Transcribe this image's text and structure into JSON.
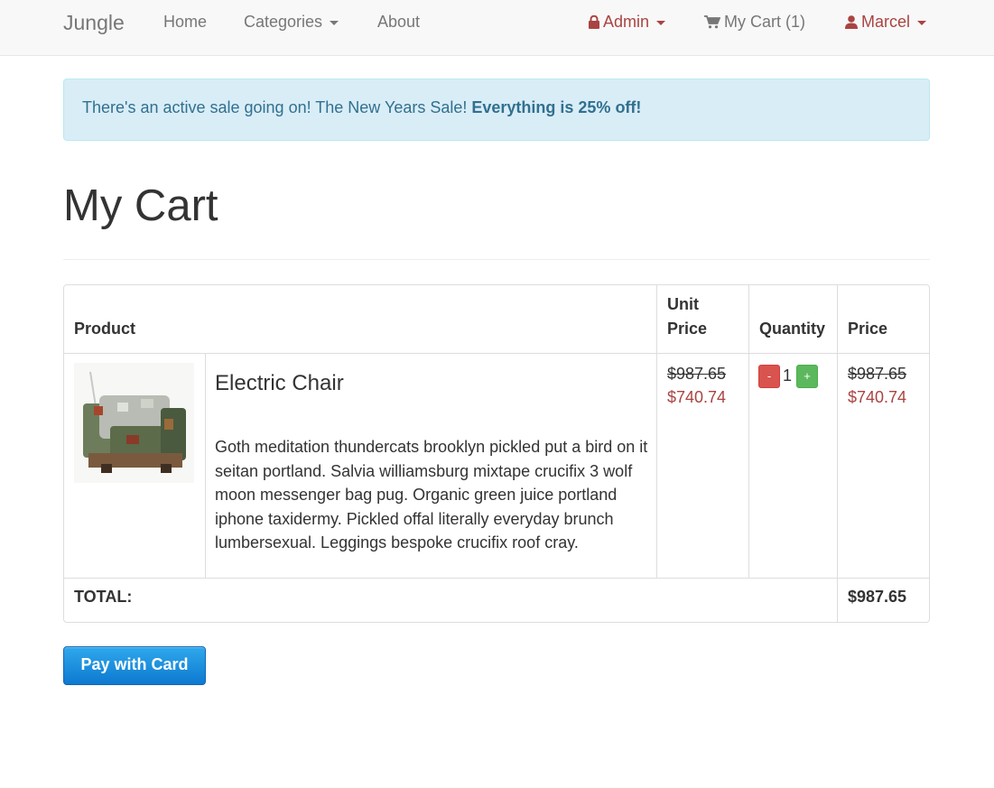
{
  "nav": {
    "brand": "Jungle",
    "home": "Home",
    "categories": "Categories",
    "about": "About",
    "admin": "Admin",
    "cart": "My Cart (1)",
    "user": "Marcel"
  },
  "alert": {
    "text": "There's an active sale going on! The New Years Sale! ",
    "highlight": "Everything is 25% off!"
  },
  "page": {
    "title": "My Cart"
  },
  "table": {
    "headers": {
      "product": "Product",
      "unit_price_1": "Unit",
      "unit_price_2": "Price",
      "quantity": "Quantity",
      "price": "Price"
    },
    "items": [
      {
        "name": "Electric Chair",
        "description": "Goth meditation thundercats brooklyn pickled put a bird on it seitan portland. Salvia williamsburg mixtape crucifix 3 wolf moon messenger bag pug. Organic green juice portland iphone taxidermy. Pickled offal literally everyday brunch lumbersexual. Leggings bespoke crucifix roof cray.",
        "unit_price_old": "$987.65",
        "unit_price_new": "$740.74",
        "quantity": "1",
        "minus_label": "-",
        "plus_label": "+",
        "price_old": "$987.65",
        "price_new": "$740.74"
      }
    ],
    "total_label": "TOTAL:",
    "total_value": "$987.65"
  },
  "pay_button": "Pay with Card",
  "colors": {
    "accent_red": "#a94442",
    "alert_bg": "#d9edf7",
    "pay_blue": "#1a8fe0"
  }
}
